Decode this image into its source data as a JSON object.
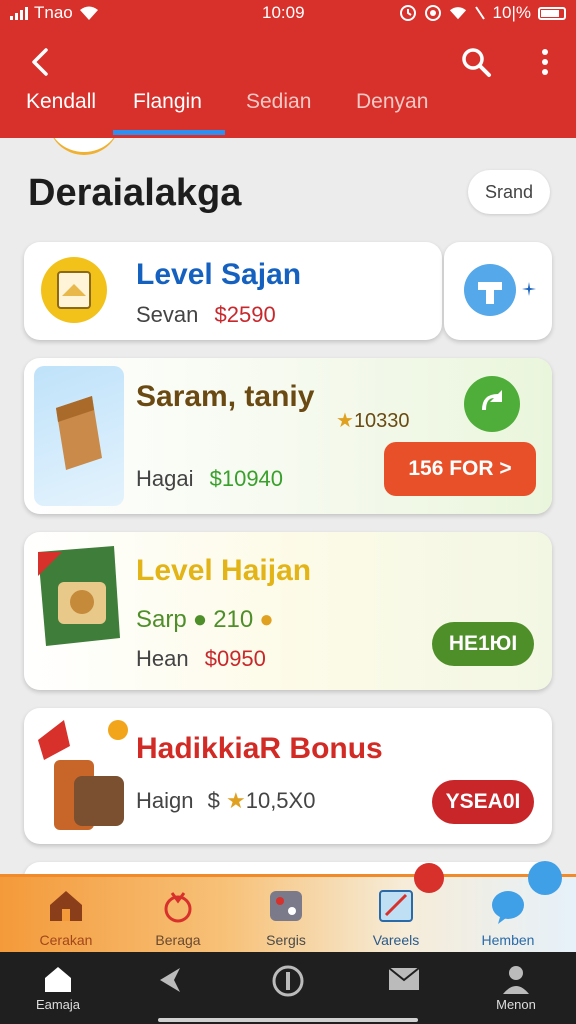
{
  "status": {
    "carrier": "Tnao",
    "time": "10:09",
    "battery": "10|%"
  },
  "tabs": [
    {
      "label": "Kendall"
    },
    {
      "label": "Flangin"
    },
    {
      "label": "Sedian"
    },
    {
      "label": "Denyan"
    }
  ],
  "section": {
    "title": "Deraialakga",
    "chip": "Srand"
  },
  "cards": [
    {
      "title": "Level Sajan",
      "subtitle": "Sevan",
      "price": "$2590"
    },
    {
      "title": "Saram, taniy",
      "rating": "10330",
      "subtitle": "Hagai",
      "price": "$10940",
      "button": "156 FOR >"
    },
    {
      "title": "Level Haijan",
      "meta_label": "Sarp",
      "meta_value": "210",
      "subtitle": "Hean",
      "price": "$0950",
      "button": "НЕ1ЮI"
    },
    {
      "title": "HadikkiaR Bonus",
      "subtitle": "Haign",
      "price": "10,5X0",
      "button": "YSEA0I"
    }
  ],
  "bottom_nav": [
    {
      "label": "Cerakan"
    },
    {
      "label": "Beraga"
    },
    {
      "label": "Sergis"
    },
    {
      "label": "Vareels"
    },
    {
      "label": "Hemben"
    }
  ],
  "system_nav": [
    {
      "label": "Eamaja"
    },
    {
      "label": "Menon"
    }
  ],
  "colors": {
    "app_bar": "#d8302b",
    "tab_indicator": "#2f8ff0",
    "card1_title": "#1561c0",
    "card1_price": "#c8282c",
    "card2_title": "#6a4a12",
    "card2_price": "#3aa02c",
    "card2_button": "#e8502a",
    "card3_title": "#e3b417",
    "card3_price": "#c8282c",
    "card3_button": "#4f8f2a",
    "card4_title": "#d22a24",
    "card4_button": "#c82628"
  }
}
